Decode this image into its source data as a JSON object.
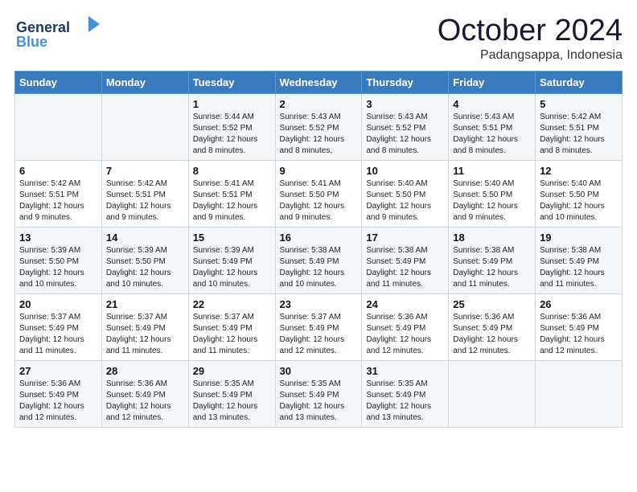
{
  "header": {
    "logo_line1": "General",
    "logo_line2": "Blue",
    "month": "October 2024",
    "location": "Padangsappa, Indonesia"
  },
  "weekdays": [
    "Sunday",
    "Monday",
    "Tuesday",
    "Wednesday",
    "Thursday",
    "Friday",
    "Saturday"
  ],
  "rows": [
    [
      {
        "day": "",
        "sunrise": "",
        "sunset": "",
        "daylight": ""
      },
      {
        "day": "",
        "sunrise": "",
        "sunset": "",
        "daylight": ""
      },
      {
        "day": "1",
        "sunrise": "Sunrise: 5:44 AM",
        "sunset": "Sunset: 5:52 PM",
        "daylight": "Daylight: 12 hours and 8 minutes."
      },
      {
        "day": "2",
        "sunrise": "Sunrise: 5:43 AM",
        "sunset": "Sunset: 5:52 PM",
        "daylight": "Daylight: 12 hours and 8 minutes."
      },
      {
        "day": "3",
        "sunrise": "Sunrise: 5:43 AM",
        "sunset": "Sunset: 5:52 PM",
        "daylight": "Daylight: 12 hours and 8 minutes."
      },
      {
        "day": "4",
        "sunrise": "Sunrise: 5:43 AM",
        "sunset": "Sunset: 5:51 PM",
        "daylight": "Daylight: 12 hours and 8 minutes."
      },
      {
        "day": "5",
        "sunrise": "Sunrise: 5:42 AM",
        "sunset": "Sunset: 5:51 PM",
        "daylight": "Daylight: 12 hours and 8 minutes."
      }
    ],
    [
      {
        "day": "6",
        "sunrise": "Sunrise: 5:42 AM",
        "sunset": "Sunset: 5:51 PM",
        "daylight": "Daylight: 12 hours and 9 minutes."
      },
      {
        "day": "7",
        "sunrise": "Sunrise: 5:42 AM",
        "sunset": "Sunset: 5:51 PM",
        "daylight": "Daylight: 12 hours and 9 minutes."
      },
      {
        "day": "8",
        "sunrise": "Sunrise: 5:41 AM",
        "sunset": "Sunset: 5:51 PM",
        "daylight": "Daylight: 12 hours and 9 minutes."
      },
      {
        "day": "9",
        "sunrise": "Sunrise: 5:41 AM",
        "sunset": "Sunset: 5:50 PM",
        "daylight": "Daylight: 12 hours and 9 minutes."
      },
      {
        "day": "10",
        "sunrise": "Sunrise: 5:40 AM",
        "sunset": "Sunset: 5:50 PM",
        "daylight": "Daylight: 12 hours and 9 minutes."
      },
      {
        "day": "11",
        "sunrise": "Sunrise: 5:40 AM",
        "sunset": "Sunset: 5:50 PM",
        "daylight": "Daylight: 12 hours and 9 minutes."
      },
      {
        "day": "12",
        "sunrise": "Sunrise: 5:40 AM",
        "sunset": "Sunset: 5:50 PM",
        "daylight": "Daylight: 12 hours and 10 minutes."
      }
    ],
    [
      {
        "day": "13",
        "sunrise": "Sunrise: 5:39 AM",
        "sunset": "Sunset: 5:50 PM",
        "daylight": "Daylight: 12 hours and 10 minutes."
      },
      {
        "day": "14",
        "sunrise": "Sunrise: 5:39 AM",
        "sunset": "Sunset: 5:50 PM",
        "daylight": "Daylight: 12 hours and 10 minutes."
      },
      {
        "day": "15",
        "sunrise": "Sunrise: 5:39 AM",
        "sunset": "Sunset: 5:49 PM",
        "daylight": "Daylight: 12 hours and 10 minutes."
      },
      {
        "day": "16",
        "sunrise": "Sunrise: 5:38 AM",
        "sunset": "Sunset: 5:49 PM",
        "daylight": "Daylight: 12 hours and 10 minutes."
      },
      {
        "day": "17",
        "sunrise": "Sunrise: 5:38 AM",
        "sunset": "Sunset: 5:49 PM",
        "daylight": "Daylight: 12 hours and 11 minutes."
      },
      {
        "day": "18",
        "sunrise": "Sunrise: 5:38 AM",
        "sunset": "Sunset: 5:49 PM",
        "daylight": "Daylight: 12 hours and 11 minutes."
      },
      {
        "day": "19",
        "sunrise": "Sunrise: 5:38 AM",
        "sunset": "Sunset: 5:49 PM",
        "daylight": "Daylight: 12 hours and 11 minutes."
      }
    ],
    [
      {
        "day": "20",
        "sunrise": "Sunrise: 5:37 AM",
        "sunset": "Sunset: 5:49 PM",
        "daylight": "Daylight: 12 hours and 11 minutes."
      },
      {
        "day": "21",
        "sunrise": "Sunrise: 5:37 AM",
        "sunset": "Sunset: 5:49 PM",
        "daylight": "Daylight: 12 hours and 11 minutes."
      },
      {
        "day": "22",
        "sunrise": "Sunrise: 5:37 AM",
        "sunset": "Sunset: 5:49 PM",
        "daylight": "Daylight: 12 hours and 11 minutes."
      },
      {
        "day": "23",
        "sunrise": "Sunrise: 5:37 AM",
        "sunset": "Sunset: 5:49 PM",
        "daylight": "Daylight: 12 hours and 12 minutes."
      },
      {
        "day": "24",
        "sunrise": "Sunrise: 5:36 AM",
        "sunset": "Sunset: 5:49 PM",
        "daylight": "Daylight: 12 hours and 12 minutes."
      },
      {
        "day": "25",
        "sunrise": "Sunrise: 5:36 AM",
        "sunset": "Sunset: 5:49 PM",
        "daylight": "Daylight: 12 hours and 12 minutes."
      },
      {
        "day": "26",
        "sunrise": "Sunrise: 5:36 AM",
        "sunset": "Sunset: 5:49 PM",
        "daylight": "Daylight: 12 hours and 12 minutes."
      }
    ],
    [
      {
        "day": "27",
        "sunrise": "Sunrise: 5:36 AM",
        "sunset": "Sunset: 5:49 PM",
        "daylight": "Daylight: 12 hours and 12 minutes."
      },
      {
        "day": "28",
        "sunrise": "Sunrise: 5:36 AM",
        "sunset": "Sunset: 5:49 PM",
        "daylight": "Daylight: 12 hours and 12 minutes."
      },
      {
        "day": "29",
        "sunrise": "Sunrise: 5:35 AM",
        "sunset": "Sunset: 5:49 PM",
        "daylight": "Daylight: 12 hours and 13 minutes."
      },
      {
        "day": "30",
        "sunrise": "Sunrise: 5:35 AM",
        "sunset": "Sunset: 5:49 PM",
        "daylight": "Daylight: 12 hours and 13 minutes."
      },
      {
        "day": "31",
        "sunrise": "Sunrise: 5:35 AM",
        "sunset": "Sunset: 5:49 PM",
        "daylight": "Daylight: 12 hours and 13 minutes."
      },
      {
        "day": "",
        "sunrise": "",
        "sunset": "",
        "daylight": ""
      },
      {
        "day": "",
        "sunrise": "",
        "sunset": "",
        "daylight": ""
      }
    ]
  ]
}
